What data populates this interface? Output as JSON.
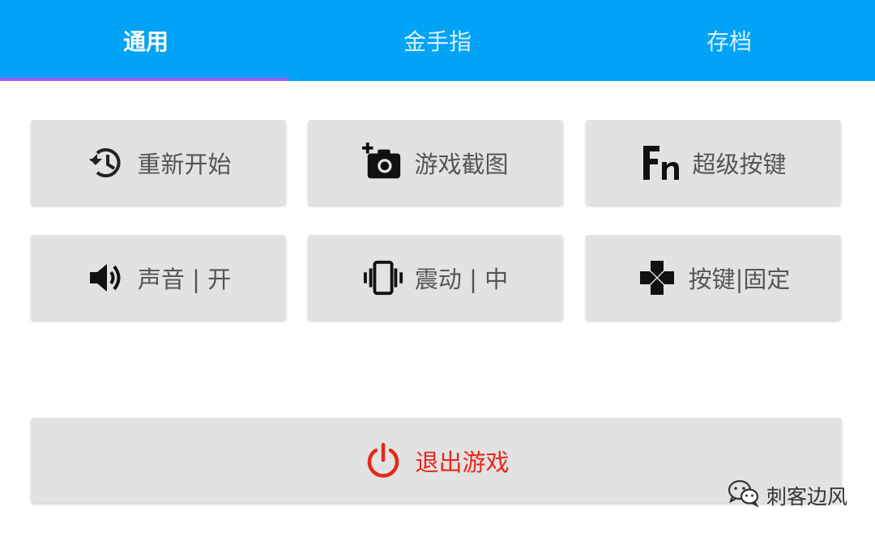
{
  "tabs": [
    {
      "label": "通用",
      "active": true
    },
    {
      "label": "金手指",
      "active": false
    },
    {
      "label": "存档",
      "active": false
    }
  ],
  "colors": {
    "tab_bar": "#00a3f5",
    "tab_indicator": "#9a5cf0",
    "button_bg": "#e2e2e2",
    "button_text": "#555555",
    "exit_red": "#e8261a"
  },
  "buttons": {
    "restart": {
      "label": "重新开始",
      "icon": "history-icon"
    },
    "screenshot": {
      "label": "游戏截图",
      "icon": "add-camera-icon"
    },
    "super_key": {
      "label": "超级按键",
      "icon": "fn-icon"
    },
    "sound": {
      "label": "声音 | 开",
      "icon": "speaker-icon"
    },
    "vibration": {
      "label": "震动 | 中",
      "icon": "vibration-icon"
    },
    "key_fixed": {
      "label": "按键|固定",
      "icon": "dpad-icon"
    }
  },
  "exit": {
    "label": "退出游戏",
    "icon": "power-icon"
  },
  "watermark": {
    "text": "刺客边风",
    "icon": "wechat-icon"
  }
}
